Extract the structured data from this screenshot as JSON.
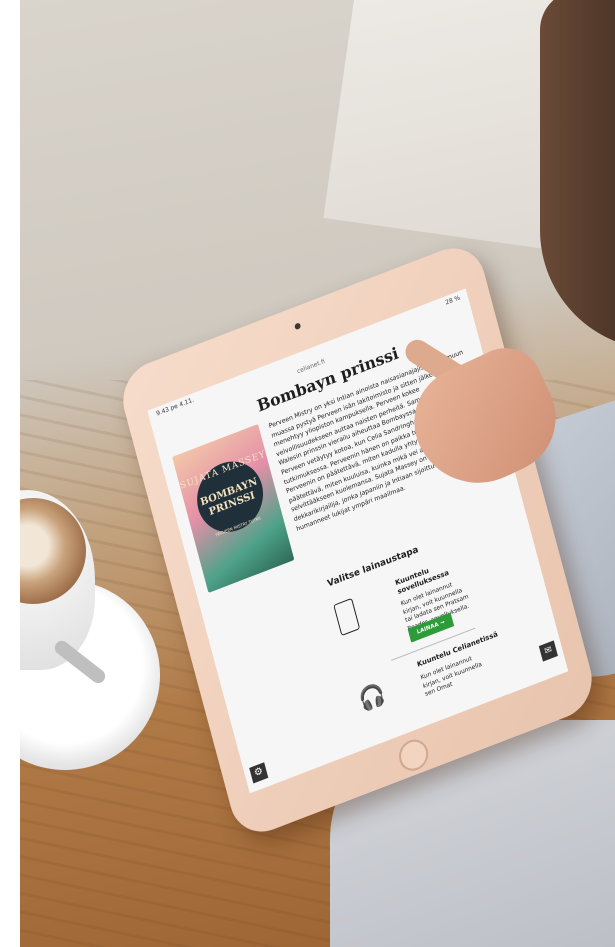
{
  "screen": {
    "status_time": "9.43  pe 4.11.",
    "status_battery": "28 %",
    "url": "celianet.fi",
    "book_title": "Bombayn prinssi",
    "cover": {
      "author": "SUJATA MASSEY",
      "title_line1": "BOMBAYN",
      "title_line2": "PRINSSI",
      "subtitle": "PERVEEN MISTRY TUTKII"
    },
    "description": "Perveen Mistry on yksi Intian ainoista naisasianajajista. Kun muun muassa pystyä Perveen isän lakitoimisto ja sitten jälkeen menehtyy yliopiston kampuksella. Perveen kokee velvollisuudekseen auttaa naisten perheitä. Samaan aikaan Walesin prinssin vierailu aiheuttaa Bombayssa levottomuuksia. Perveen vetäytyy kotoa, kun Celia Sandringhamin. Kohtaaminen tutkimuksessa. Perveenin hänen on paikka tutkittava ensin ja Perveenin on päätettävä, miten kadulla yhtyvät, ja Perveenin on päätettävä, miten kuuluisa, kuinka mikä vei antavaa selvittääkseen kuolemansa. Sujata Massey on palkittu dekkarikirjailija, jonka Japaniin ja Intiaan sijoittuvat sarjat ovat humanneet lukijat ympäri maailmaa.",
    "loan_heading": "Valitse lainaustapa",
    "option_app": {
      "title": "Kuuntelu sovelluksessa",
      "text": "Kun olet lainannut kirjan, voit kuunnella tai ladata sen Pratsam Reader -sovelluksella.",
      "button": "LAINAA  →"
    },
    "option_web": {
      "title": "Kuuntelu Celianetissä",
      "text": "Kun olet lainannut kirjan, voit kuunnella sen Omat"
    }
  }
}
